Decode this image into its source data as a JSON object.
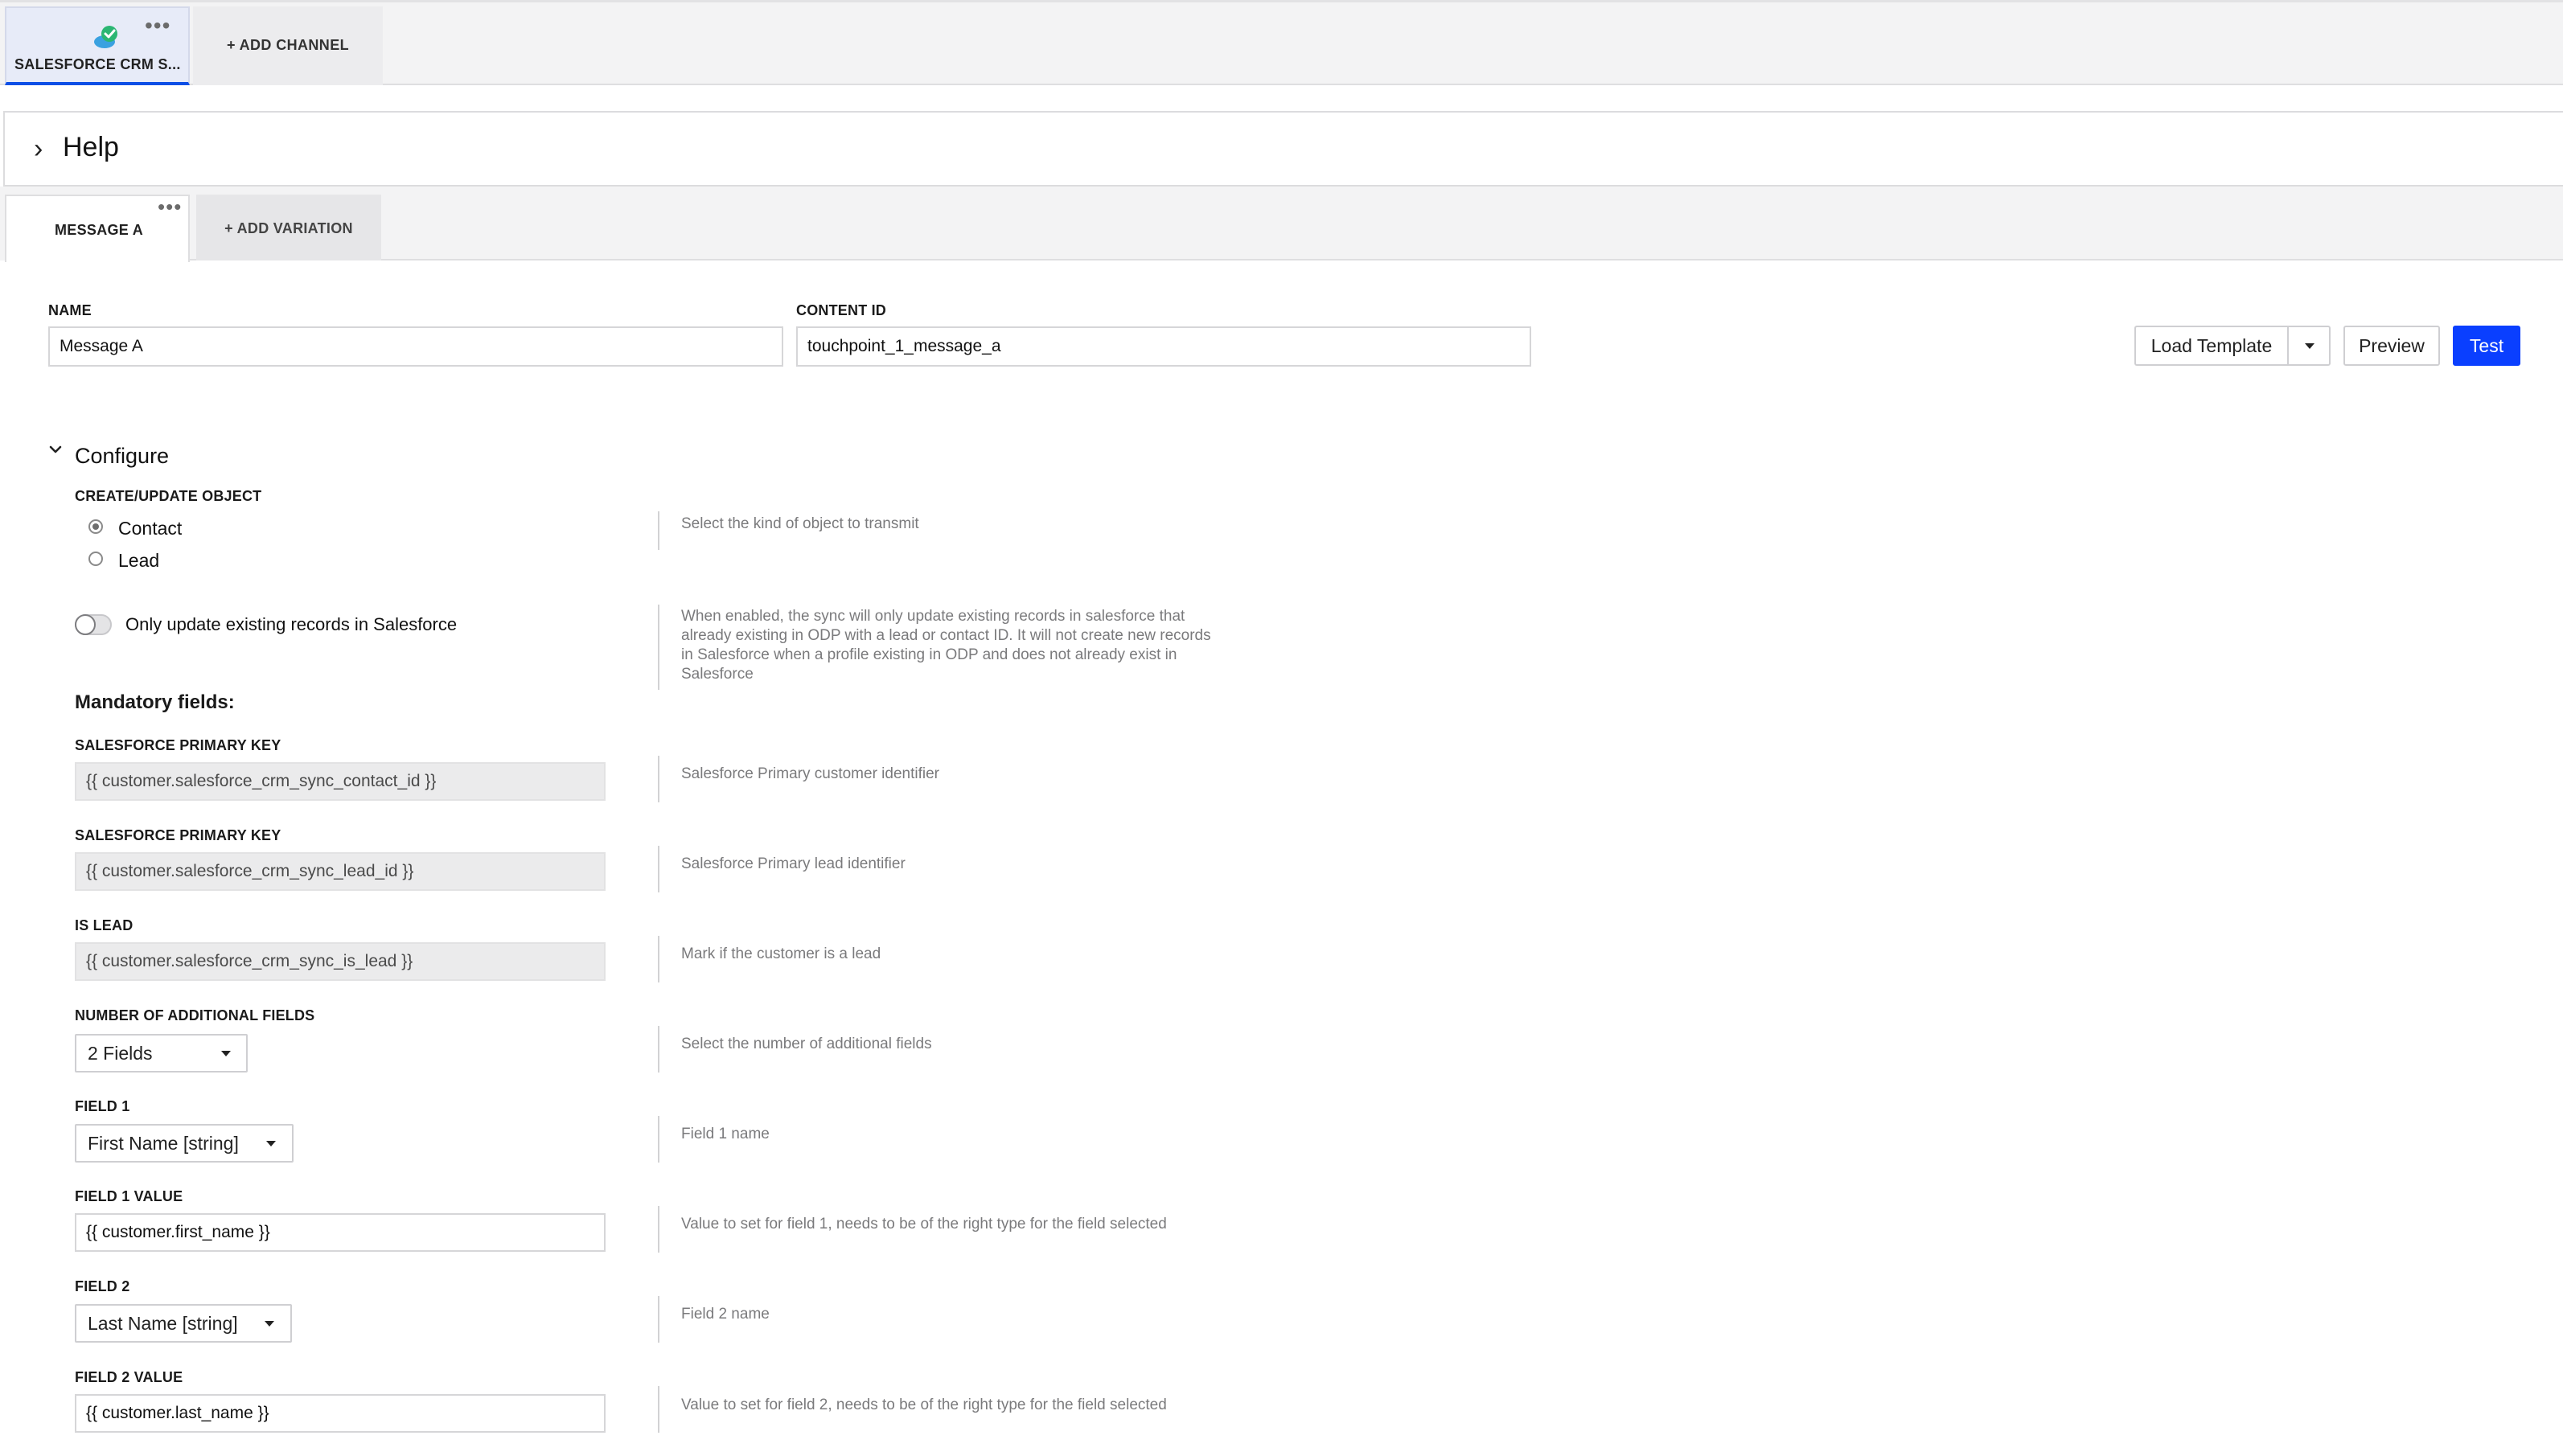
{
  "channel_tabs": {
    "active_label": "SALESFORCE CRM S...",
    "add_label": "+ ADD CHANNEL"
  },
  "help": {
    "title": "Help"
  },
  "message_tabs": {
    "active_label": "MESSAGE A",
    "add_label": "+ ADD VARIATION"
  },
  "header_fields": {
    "name_label": "NAME",
    "name_value": "Message A",
    "content_id_label": "CONTENT ID",
    "content_id_value": "touchpoint_1_message_a"
  },
  "actions": {
    "load_template": "Load Template",
    "preview": "Preview",
    "test": "Test"
  },
  "configure": {
    "title": "Configure",
    "object_label": "CREATE/UPDATE OBJECT",
    "object_options": [
      "Contact",
      "Lead"
    ],
    "object_selected": "Contact",
    "object_hint": "Select the kind of object to transmit",
    "toggle_label": "Only update existing records in Salesforce",
    "toggle_on": false,
    "toggle_hint_lines": [
      "When enabled, the sync will only update existing records in salesforce that",
      "already existing in ODP with a lead or contact ID. It will not create new records",
      "in Salesforce when a profile existing in ODP and does not already exist in",
      "Salesforce"
    ],
    "mandatory_title": "Mandatory fields:",
    "fields": [
      {
        "label": "SALESFORCE PRIMARY KEY",
        "value": "{{ customer.salesforce_crm_sync_contact_id }}",
        "hint": "Salesforce Primary customer identifier"
      },
      {
        "label": "SALESFORCE PRIMARY KEY",
        "value": "{{ customer.salesforce_crm_sync_lead_id }}",
        "hint": "Salesforce Primary lead identifier"
      },
      {
        "label": "IS LEAD",
        "value": "{{ customer.salesforce_crm_sync_is_lead }}",
        "hint": "Mark if the customer is a lead"
      },
      {
        "label": "NUMBER OF ADDITIONAL FIELDS",
        "value": "2 Fields",
        "hint": "Select the number of additional fields"
      },
      {
        "label": "FIELD 1",
        "value": "First Name [string]",
        "hint": "Field 1 name"
      },
      {
        "label": "FIELD 1 VALUE",
        "value": "{{ customer.first_name }}",
        "hint": "Value to set for field 1, needs to be of the right type for the field selected"
      },
      {
        "label": "FIELD 2",
        "value": "Last Name [string]",
        "hint": "Field 2 name"
      },
      {
        "label": "FIELD 2 VALUE",
        "value": "{{ customer.last_name }}",
        "hint": "Value to set for field 2, needs to be of the right type for the field selected"
      }
    ]
  },
  "colors": {
    "accent": "#0a3fff",
    "success": "#2bb673",
    "active_tab_bg": "#e7ebf8"
  },
  "icons": {
    "channel": "salesforce-cloud-check-icon",
    "more": "more-dots-icon",
    "expand": "chevron-right-icon",
    "collapse": "chevron-down-icon",
    "dropdown": "caret-down-icon"
  }
}
